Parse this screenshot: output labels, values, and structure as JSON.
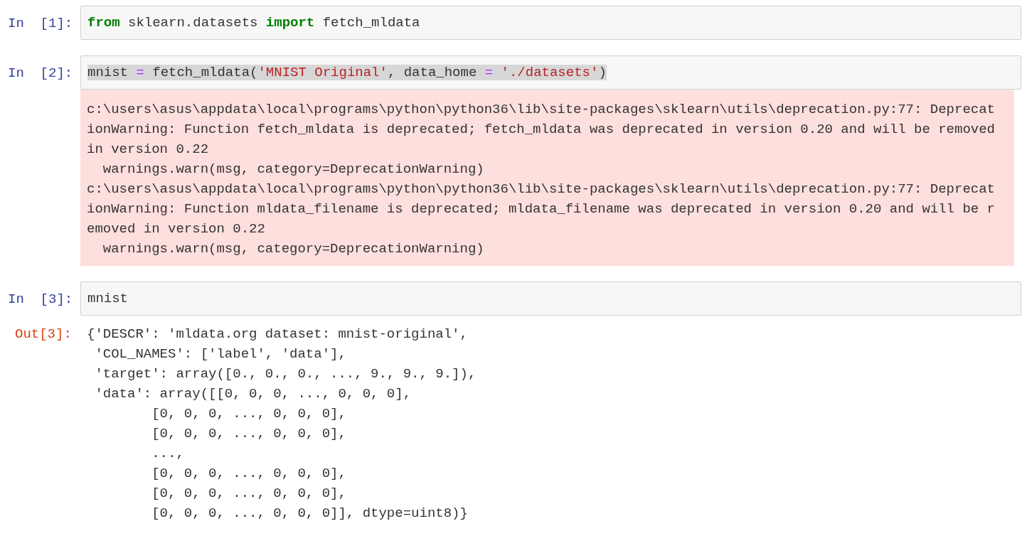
{
  "cells": [
    {
      "prompt": "In  [1]:",
      "highlighted": false,
      "code": [
        {
          "text": "from",
          "kind": "keyword"
        },
        {
          "text": " sklearn.datasets ",
          "kind": "plain"
        },
        {
          "text": "import",
          "kind": "keyword"
        },
        {
          "text": " fetch_mldata",
          "kind": "plain"
        }
      ]
    },
    {
      "prompt": "In  [2]:",
      "highlighted": true,
      "code": [
        {
          "text": "mnist ",
          "kind": "plain"
        },
        {
          "text": "=",
          "kind": "operator"
        },
        {
          "text": " fetch_mldata(",
          "kind": "plain"
        },
        {
          "text": "'MNIST Original'",
          "kind": "string"
        },
        {
          "text": ", data_home ",
          "kind": "plain"
        },
        {
          "text": "=",
          "kind": "operator"
        },
        {
          "text": " './datasets'",
          "kind": "string"
        },
        {
          "text": ")",
          "kind": "plain"
        }
      ],
      "output": {
        "kind": "stderr",
        "lines": [
          "c:\\users\\asus\\appdata\\local\\programs\\python\\python36\\lib\\site-packages\\sklearn\\utils\\deprecation.py:77: Deprecat",
          "ionWarning: Function fetch_mldata is deprecated; fetch_mldata was deprecated in version 0.20 and will be removed",
          "in version 0.22",
          "  warnings.warn(msg, category=DeprecationWarning)",
          "c:\\users\\asus\\appdata\\local\\programs\\python\\python36\\lib\\site-packages\\sklearn\\utils\\deprecation.py:77: Deprecat",
          "ionWarning: Function mldata_filename is deprecated; mldata_filename was deprecated in version 0.20 and will be r",
          "emoved in version 0.22",
          "  warnings.warn(msg, category=DeprecationWarning)"
        ]
      }
    },
    {
      "prompt": "In  [3]:",
      "highlighted": false,
      "code": [
        {
          "text": "mnist",
          "kind": "plain"
        }
      ],
      "output": {
        "kind": "result",
        "prompt": "Out[3]:",
        "lines": [
          "{'DESCR': 'mldata.org dataset: mnist-original',",
          " 'COL_NAMES': ['label', 'data'],",
          " 'target': array([0., 0., 0., ..., 9., 9., 9.]),",
          " 'data': array([[0, 0, 0, ..., 0, 0, 0],",
          "        [0, 0, 0, ..., 0, 0, 0],",
          "        [0, 0, 0, ..., 0, 0, 0],",
          "        ...,",
          "        [0, 0, 0, ..., 0, 0, 0],",
          "        [0, 0, 0, ..., 0, 0, 0],",
          "        [0, 0, 0, ..., 0, 0, 0]], dtype=uint8)}"
        ]
      }
    }
  ]
}
